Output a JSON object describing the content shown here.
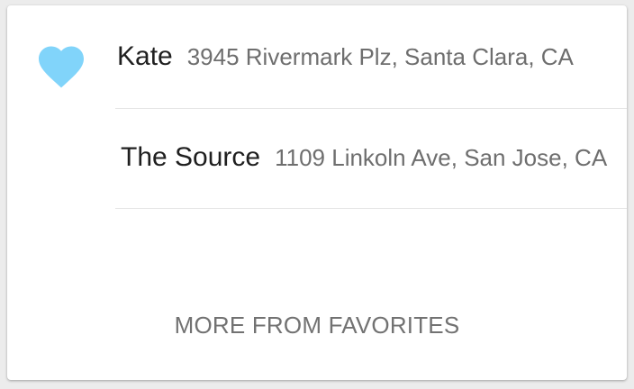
{
  "favorites": {
    "icon": "heart-icon",
    "icon_color": "#81d4fa",
    "items": [
      {
        "name": "Kate",
        "address": "3945 Rivermark Plz, Santa Clara, CA"
      },
      {
        "name": "The Source",
        "address": "1109 Linkoln Ave, San Jose, CA"
      }
    ],
    "more_label": "MORE FROM FAVORITES"
  }
}
